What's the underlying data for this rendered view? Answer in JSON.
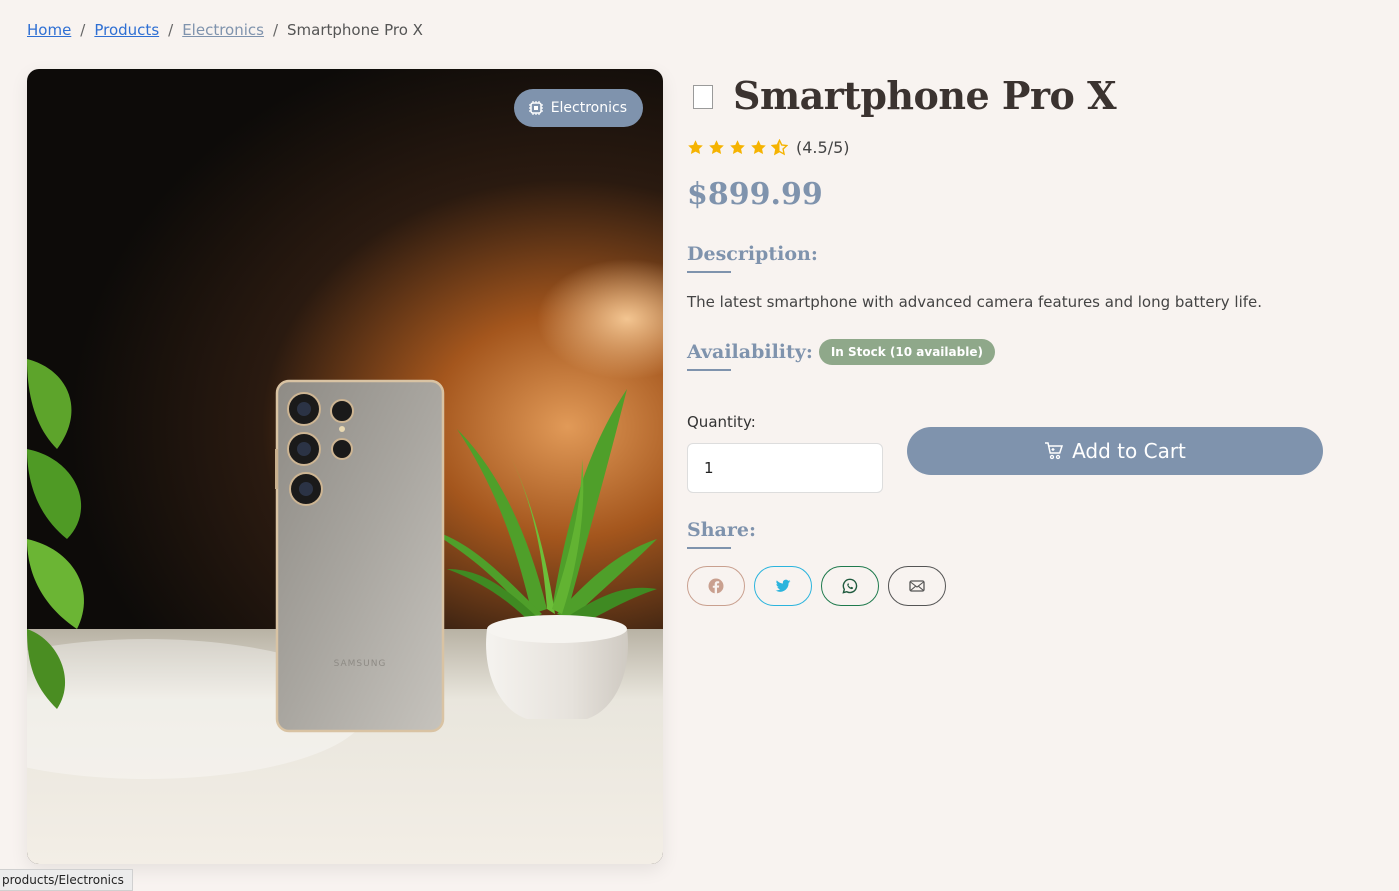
{
  "breadcrumb": {
    "home": "Home",
    "products": "Products",
    "category": "Electronics",
    "current": "Smartphone Pro X",
    "separator": "/"
  },
  "image": {
    "category_badge": "Electronics",
    "badge_icon": "chip-icon",
    "phone_brand": "SAMSUNG"
  },
  "product": {
    "title": "Smartphone Pro X",
    "rating": 4.5,
    "rating_text": "(4.5/5)",
    "price": "$899.99",
    "description_heading": "Description:",
    "description": "The latest smartphone with advanced camera features and long battery life.",
    "availability_heading": "Availability:",
    "stock_badge": "In Stock (10 available)"
  },
  "purchase": {
    "quantity_label": "Quantity:",
    "quantity_value": "1",
    "add_to_cart": "Add to Cart"
  },
  "share": {
    "heading": "Share:",
    "buttons": [
      "facebook-icon",
      "twitter-icon",
      "whatsapp-icon",
      "email-icon"
    ]
  },
  "status_bar": {
    "url": "products/Electronics"
  },
  "colors": {
    "accent": "#7f93ad",
    "background": "#f8f3f0",
    "stock_badge": "#8fa88a",
    "star": "#f5b301",
    "link": "#2e6fd3"
  }
}
